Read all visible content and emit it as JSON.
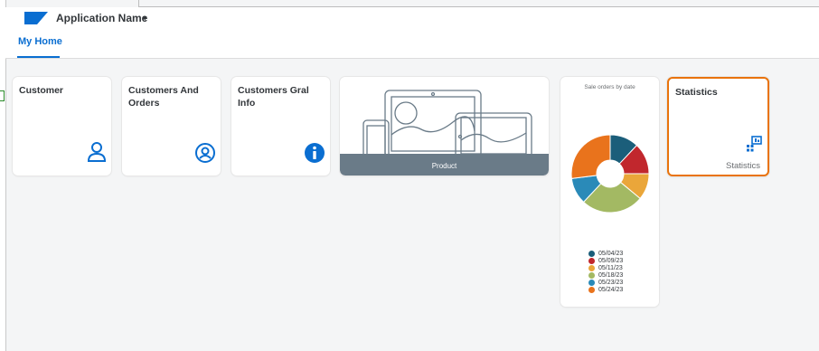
{
  "header": {
    "app_name": "Application Name",
    "caret": "▾",
    "logo_color": "#0a6ed1"
  },
  "tabs": [
    {
      "label": "My Home",
      "active": true
    }
  ],
  "tiles": {
    "customer": {
      "title": "Customer",
      "icon": "user-icon"
    },
    "customers_orders": {
      "title": "Customers And Orders",
      "icon": "user-circle-icon"
    },
    "customers_gral": {
      "title": "Customers Gral Info",
      "icon": "info-icon"
    },
    "product": {
      "label": "Product",
      "icon": "devices-illustration"
    },
    "statistics": {
      "title": "Statistics",
      "subtitle": "Statistics",
      "icon": "chart-icon",
      "highlight_color": "#e9730c"
    }
  },
  "chart_data": {
    "type": "pie",
    "title": "Sale orders by date",
    "donut": true,
    "categories": [
      "05/04/23",
      "05/09/23",
      "05/11/23",
      "05/18/23",
      "05/23/23",
      "05/24/23"
    ],
    "values": [
      12,
      13,
      11,
      26,
      11,
      27
    ],
    "colors": [
      "#1b5e7a",
      "#c1272d",
      "#eaa63a",
      "#a3b963",
      "#2a8ab8",
      "#e9731c"
    ]
  }
}
